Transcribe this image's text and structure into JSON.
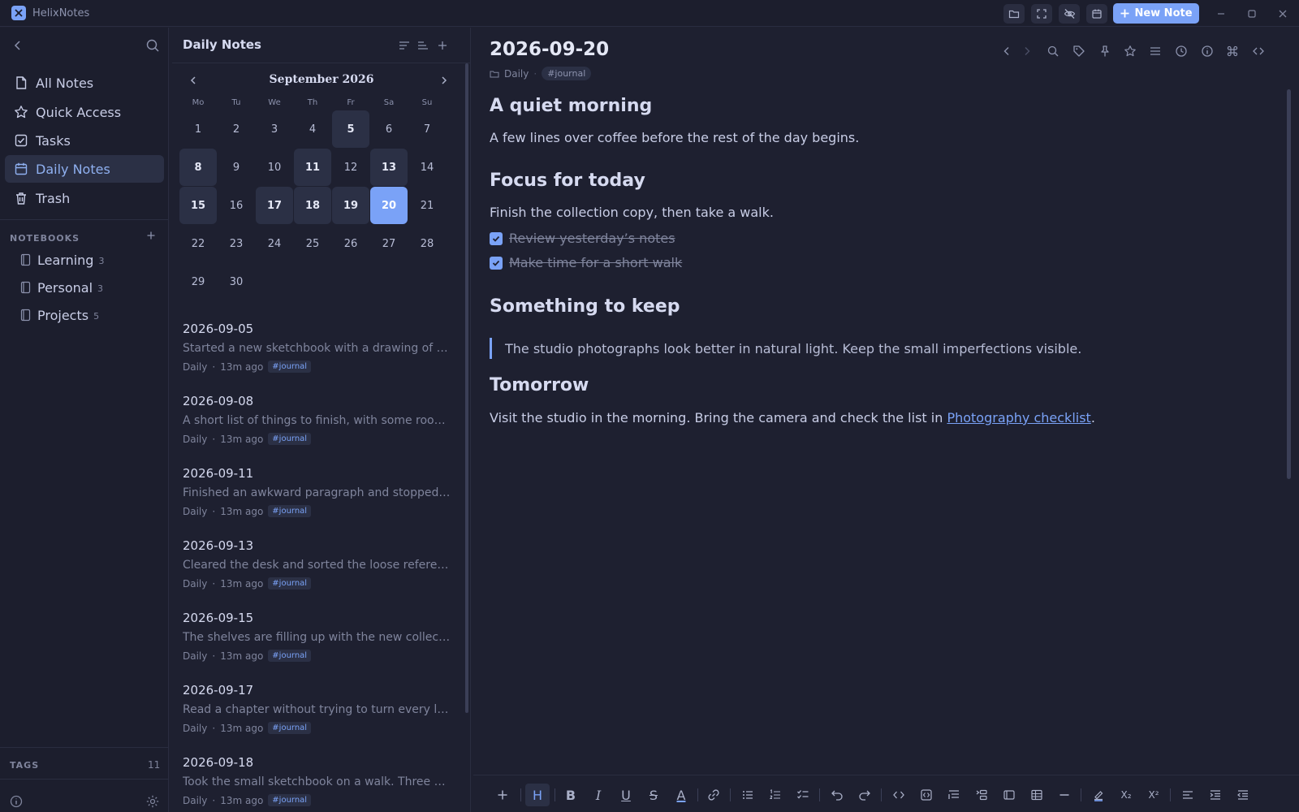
{
  "app": {
    "title": "HelixNotes",
    "new_note_label": "New Note",
    "accent": "#7aa2f7"
  },
  "sidebar": {
    "nav_items": [
      {
        "label": "All Notes",
        "icon": "file-icon"
      },
      {
        "label": "Quick Access",
        "icon": "star-icon"
      },
      {
        "label": "Tasks",
        "icon": "checkbox-icon"
      },
      {
        "label": "Daily Notes",
        "icon": "calendar-icon",
        "active": true
      },
      {
        "label": "Trash",
        "icon": "trash-icon"
      }
    ],
    "notebooks_title": "NOTEBOOKS",
    "notebooks": [
      {
        "name": "Learning",
        "count": "3"
      },
      {
        "name": "Personal",
        "count": "3"
      },
      {
        "name": "Projects",
        "count": "5"
      }
    ],
    "tags_title": "TAGS",
    "tags_count": "11"
  },
  "list_pane": {
    "title": "Daily Notes",
    "calendar": {
      "month": "September 2026",
      "weekdays": [
        "Mo",
        "Tu",
        "We",
        "Th",
        "Fr",
        "Sa",
        "Su"
      ],
      "days": [
        "1",
        "2",
        "3",
        "4",
        "5",
        "6",
        "7",
        "8",
        "9",
        "10",
        "11",
        "12",
        "13",
        "14",
        "15",
        "16",
        "17",
        "18",
        "19",
        "20",
        "21",
        "22",
        "23",
        "24",
        "25",
        "26",
        "27",
        "28",
        "29",
        "30"
      ],
      "first_weekday_index": 1,
      "days_with_notes": [
        5,
        8,
        11,
        13,
        15,
        17,
        18,
        19
      ],
      "selected_day": 20
    },
    "entries": [
      {
        "date": "2026-09-05",
        "snippet": "Started a new sketchbook with a drawing of the window, the light coming in across the desk.",
        "notebook": "Daily",
        "time": "13m ago",
        "tag": "#journal"
      },
      {
        "date": "2026-09-08",
        "snippet": "A short list of things to finish, with some room for the afternoon walk.",
        "notebook": "Daily",
        "time": "13m ago",
        "tag": "#journal"
      },
      {
        "date": "2026-09-11",
        "snippet": "Finished an awkward paragraph and stopped there for the night.",
        "notebook": "Daily",
        "time": "13m ago",
        "tag": "#journal"
      },
      {
        "date": "2026-09-13",
        "snippet": "Cleared the desk and sorted the loose references into folders.",
        "notebook": "Daily",
        "time": "13m ago",
        "tag": "#journal"
      },
      {
        "date": "2026-09-15",
        "snippet": "The shelves are filling up with the new collection pieces.",
        "notebook": "Daily",
        "time": "13m ago",
        "tag": "#journal"
      },
      {
        "date": "2026-09-17",
        "snippet": "Read a chapter without trying to turn every line into a note.",
        "notebook": "Daily",
        "time": "13m ago",
        "tag": "#journal"
      },
      {
        "date": "2026-09-18",
        "snippet": "Took the small sketchbook on a walk. Three quick drawings.",
        "notebook": "Daily",
        "time": "13m ago",
        "tag": "#journal"
      }
    ]
  },
  "editor": {
    "title": "2026-09-20",
    "notebook": "Daily",
    "tag": "#journal",
    "h_morning": "A quiet morning",
    "p_morning": "A few lines over coffee before the rest of the day begins.",
    "h_focus": "Focus for today",
    "p_focus": "Finish the collection copy, then take a walk.",
    "tasks": [
      {
        "label": "Review yesterday’s notes",
        "done": true
      },
      {
        "label": "Make time for a short walk",
        "done": true
      }
    ],
    "h_keep": "Something to keep",
    "quote": "The studio photographs look better in natural light. Keep the small imperfections visible.",
    "h_tomorrow": "Tomorrow",
    "p_tomorrow_before": "Visit the studio in the morning. Bring the camera and check the list in ",
    "link_text": "Photography checklist",
    "p_tomorrow_after": "."
  },
  "format_bar": {
    "heading_label": "H",
    "bold_label": "B",
    "italic_label": "I",
    "underline_label": "U",
    "strike_label": "S",
    "color_label": "A",
    "subscript_label": "X₂",
    "superscript_label": "X²"
  }
}
